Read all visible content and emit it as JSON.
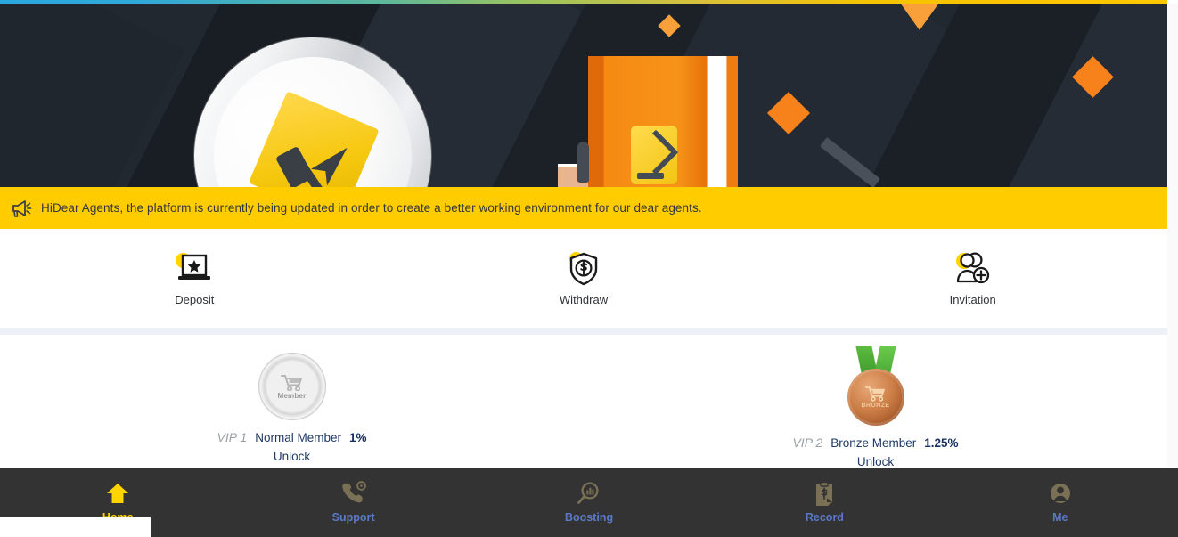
{
  "notice": {
    "icon": "megaphone-icon",
    "text": "HiDear Agents, the platform is currently being updated in order to create a better working environment for our dear agents."
  },
  "hero": {
    "alt": "promotional banner with silver coin and orange book illustration"
  },
  "quick_actions": [
    {
      "icon": "deposit-laptop-star-icon",
      "label": "Deposit"
    },
    {
      "icon": "withdraw-shield-dollar-icon",
      "label": "Withdraw"
    },
    {
      "icon": "invitation-add-user-icon",
      "label": "Invitation"
    }
  ],
  "vip_levels": [
    {
      "badge": "silver-member-coin-icon",
      "badge_caption": "Member",
      "level": "VIP 1",
      "name": "Normal Member",
      "rate": "1%",
      "unlock": "Unlock"
    },
    {
      "badge": "bronze-medal-icon",
      "badge_caption": "BRONZE",
      "level": "VIP 2",
      "name": "Bronze Member",
      "rate": "1.25%",
      "unlock": "Unlock"
    }
  ],
  "bottom_nav": [
    {
      "icon": "home-icon",
      "label": "Home",
      "active": true
    },
    {
      "icon": "support-phone-icon",
      "label": "Support",
      "active": false
    },
    {
      "icon": "boosting-magnifier-chart-icon",
      "label": "Boosting",
      "active": false
    },
    {
      "icon": "record-clipboard-dollar-icon",
      "label": "Record",
      "active": false
    },
    {
      "icon": "me-user-icon",
      "label": "Me",
      "active": false
    }
  ],
  "colors": {
    "notice_bg": "#ffcc00",
    "accent_yellow": "#ffd400",
    "nav_bg": "#333333",
    "nav_label": "#5b79c4",
    "nav_active_label": "#ffd400",
    "hero_bg": "#222830",
    "orange": "#f7821b",
    "divider": "#edf0f7"
  }
}
